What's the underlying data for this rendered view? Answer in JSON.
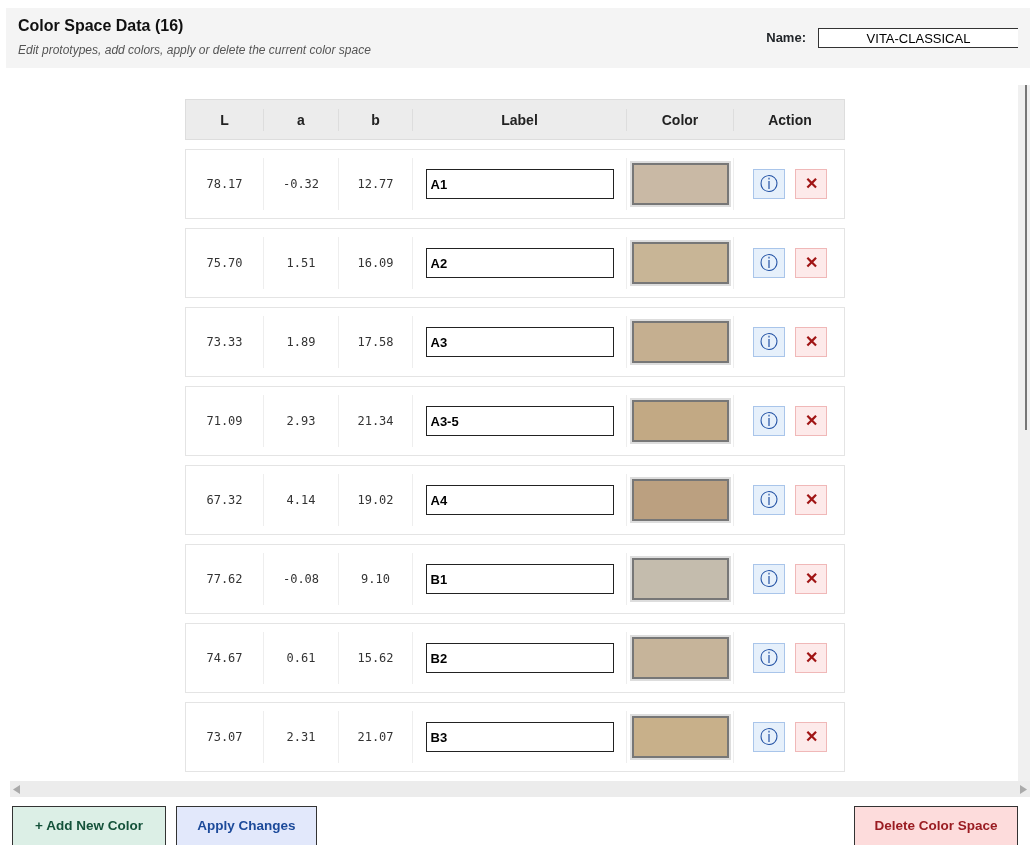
{
  "header": {
    "title": "Color Space Data (16)",
    "subtitle": "Edit prototypes, add colors, apply or delete the current color space",
    "name_label": "Name:",
    "name_value": "VITA-CLASSICAL"
  },
  "table": {
    "columns": [
      "L",
      "a",
      "b",
      "Label",
      "Color",
      "Action"
    ],
    "rows": [
      {
        "L": "78.17",
        "a": "-0.32",
        "b": "12.77",
        "label": "A1",
        "color": "#c9b9a5"
      },
      {
        "L": "75.70",
        "a": "1.51",
        "b": "16.09",
        "label": "A2",
        "color": "#c8b596"
      },
      {
        "L": "73.33",
        "a": "1.89",
        "b": "17.58",
        "label": "A3",
        "color": "#c5af90"
      },
      {
        "L": "71.09",
        "a": "2.93",
        "b": "21.34",
        "label": "A3-5",
        "color": "#c2a984"
      },
      {
        "L": "67.32",
        "a": "4.14",
        "b": "19.02",
        "label": "A4",
        "color": "#bba080"
      },
      {
        "L": "77.62",
        "a": "-0.08",
        "b": "9.10",
        "label": "B1",
        "color": "#c4bcad"
      },
      {
        "L": "74.67",
        "a": "0.61",
        "b": "15.62",
        "label": "B2",
        "color": "#c6b49a"
      },
      {
        "L": "73.07",
        "a": "2.31",
        "b": "21.07",
        "label": "B3",
        "color": "#c8b08a"
      }
    ],
    "info_symbol": "ⓘ",
    "delete_symbol": "✕"
  },
  "buttons": [
    {
      "label": "+ Add New Color",
      "kind": "add"
    },
    {
      "label": "Apply Changes",
      "kind": "apply"
    },
    {
      "label": "Delete Color Space",
      "kind": "delete"
    }
  ]
}
